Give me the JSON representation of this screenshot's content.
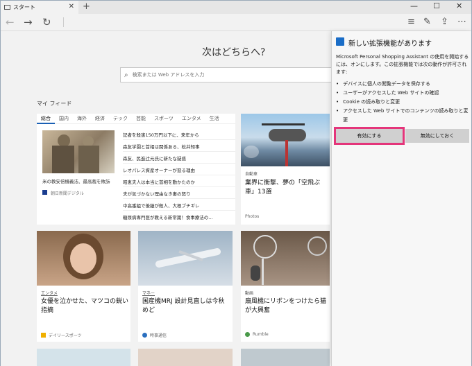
{
  "browser": {
    "tab_title": "スタート",
    "new_tab": "+",
    "window_controls": [
      "—",
      "☐",
      "✕"
    ]
  },
  "toolbar": {
    "back_icon": "back-arrow-icon",
    "forward_icon": "forward-arrow-icon",
    "refresh_icon": "refresh-icon",
    "right_icons": [
      "hub-icon",
      "notes-icon",
      "share-icon",
      "more-icon"
    ]
  },
  "start": {
    "heading": "次はどちらへ?",
    "search_placeholder": "検索または Web アドレスを入力",
    "feed_title": "マイ フィード"
  },
  "feed": {
    "categories": [
      "総合",
      "国内",
      "海外",
      "経済",
      "テック",
      "芸能",
      "スポーツ",
      "エンタメ",
      "生活"
    ],
    "main_caption": "米の教安倍機義法、最高裁を敗訴",
    "main_source": "朝日新聞デジタル",
    "headlines": [
      {
        "text": "記者を殺害150万円以下に、来年から",
        "src": "■"
      },
      {
        "text": "森友学園と首相は関係ある、松井知事",
        "src": "■"
      },
      {
        "text": "森友、民進辻元氏に新たな疑惑",
        "src": "■"
      },
      {
        "text": "レオパレス資産オーナーが怒る理由",
        "src": "■"
      },
      {
        "text": "昭恵夫人は本当に首相を動かたのか",
        "src": "■"
      },
      {
        "text": "夫が気づかない理由なき妻の怒り",
        "src": "TK"
      },
      {
        "text": "中高番組で後継が殺人、大根ブチギレ",
        "src": "■"
      },
      {
        "text": "糖尿病専門医が教える新常識！食事療法の...",
        "src": "[PR]"
      }
    ],
    "right_top": {
      "tag": "自動車",
      "title": "業界に衝撃、夢の「空飛ぶ車」13選",
      "source": "Photos"
    },
    "cards": [
      {
        "tag": "エンタメ",
        "title": "女優を泣かせた、マツコの鋭い指摘",
        "source": "デイリースポーツ"
      },
      {
        "tag": "マネー",
        "title": "国産機MRJ 設計見直しは今秋めど",
        "source": "時事通信"
      },
      {
        "tag": "動画",
        "title": "扇風機にリボンをつけたら猫が大興奮",
        "source": "Rumble"
      }
    ]
  },
  "extension": {
    "title": "新しい拡張機能があります",
    "description": "Microsoft Personal Shopping Assistant の使用を開始するには、オンにします。この拡張機能では次の動作が許可されます:",
    "permissions": [
      "デバイスに個人の閲覧データを保存する",
      "ユーザーがアクセスした Web サイトの確認",
      "Cookie の読み取りと変更",
      "アクセスした Web サイトでのコンテンツの読み取りと変更"
    ],
    "enable_label": "有効にする",
    "disable_label": "無効にしておく"
  }
}
